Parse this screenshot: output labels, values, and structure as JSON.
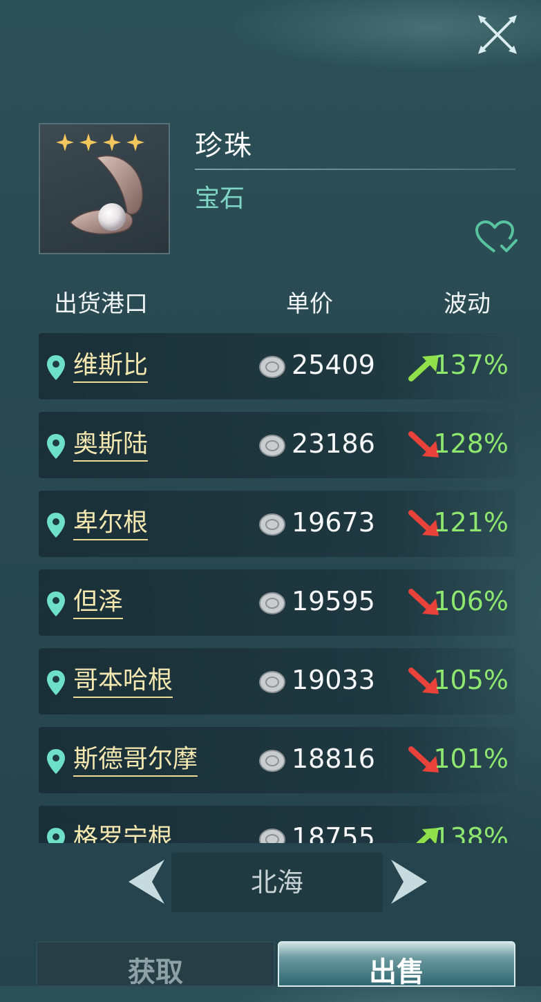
{
  "item": {
    "name": "珍珠",
    "category": "宝石",
    "stars": 4
  },
  "table": {
    "headers": {
      "port": "出货港口",
      "price": "单价",
      "change": "波动"
    },
    "rows": [
      {
        "port": "维斯比",
        "price": "25409",
        "change": "137%",
        "trend": "up"
      },
      {
        "port": "奥斯陆",
        "price": "23186",
        "change": "128%",
        "trend": "down"
      },
      {
        "port": "卑尔根",
        "price": "19673",
        "change": "121%",
        "trend": "down"
      },
      {
        "port": "但泽",
        "price": "19595",
        "change": "106%",
        "trend": "down"
      },
      {
        "port": "哥本哈根",
        "price": "19033",
        "change": "105%",
        "trend": "down"
      },
      {
        "port": "斯德哥尔摩",
        "price": "18816",
        "change": "101%",
        "trend": "down"
      },
      {
        "port": "格罗宁根",
        "price": "18755",
        "change": "138%",
        "trend": "up"
      }
    ]
  },
  "region": {
    "name": "北海"
  },
  "tabs": {
    "acquire": "获取",
    "sell": "出售",
    "active": "sell"
  },
  "colors": {
    "accent_green": "#7fd6c4",
    "up_arrow": "#8fe04a",
    "down_arrow": "#e8423a",
    "percent": "#8ee870",
    "port_name": "#f4e7b0"
  }
}
